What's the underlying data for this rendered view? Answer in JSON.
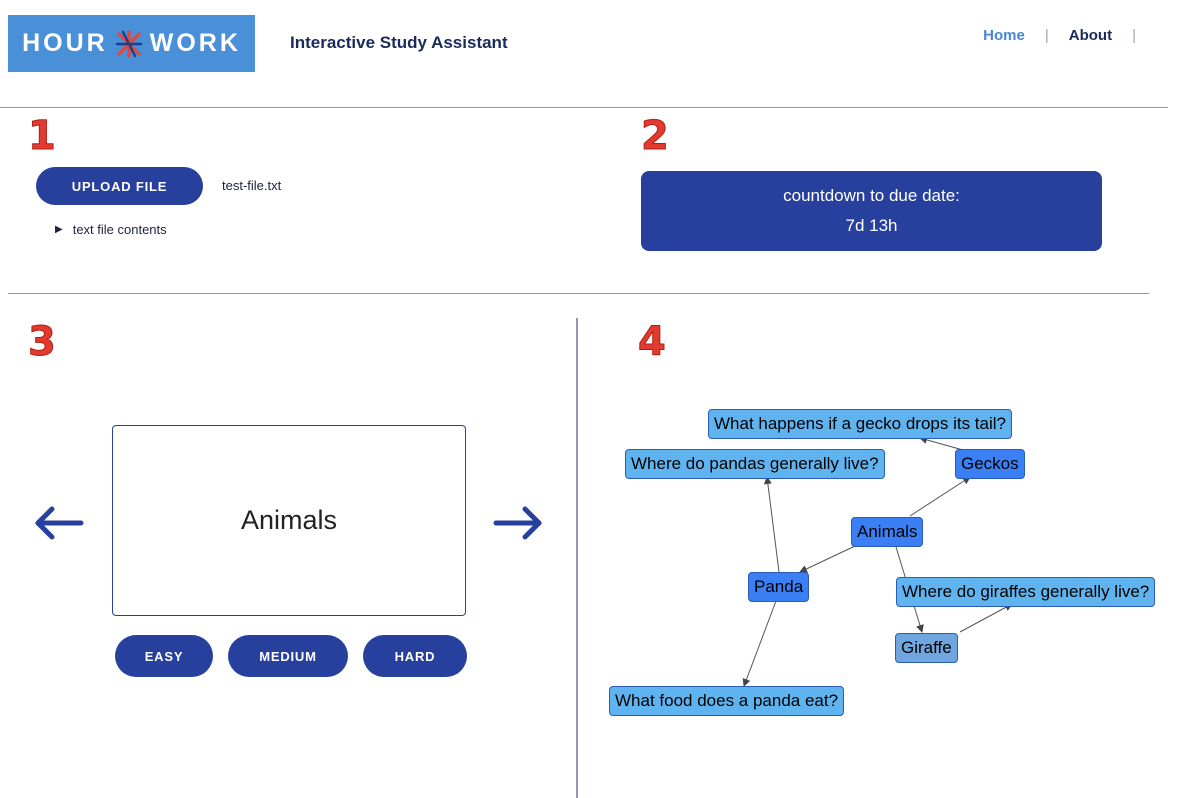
{
  "header": {
    "logo_left": "HOUR",
    "logo_right": "WORK",
    "app_title": "Interactive Study Assistant",
    "nav": [
      {
        "label": "Home",
        "active": true
      },
      {
        "label": "About",
        "active": false
      }
    ]
  },
  "steps": [
    "1",
    "2",
    "3",
    "4"
  ],
  "upload": {
    "button_label": "UPLOAD FILE",
    "file_name": "test-file.txt",
    "details_label": "text file contents"
  },
  "countdown": {
    "label": "countdown to due date:",
    "value": "7d 13h"
  },
  "flashcard": {
    "text": "Animals",
    "difficulty_buttons": [
      "EASY",
      "MEDIUM",
      "HARD"
    ]
  },
  "graph": {
    "nodes": [
      {
        "id": "q_gecko_tail",
        "label": "What happens if a gecko drops its tail?",
        "kind": "question"
      },
      {
        "id": "q_pandas_live",
        "label": "Where do pandas generally live?",
        "kind": "question"
      },
      {
        "id": "geckos",
        "label": "Geckos",
        "kind": "topic"
      },
      {
        "id": "animals",
        "label": "Animals",
        "kind": "topic"
      },
      {
        "id": "panda",
        "label": "Panda",
        "kind": "topic"
      },
      {
        "id": "q_giraffes_live",
        "label": "Where do giraffes generally live?",
        "kind": "question"
      },
      {
        "id": "giraffe",
        "label": "Giraffe",
        "kind": "topic"
      },
      {
        "id": "q_panda_food",
        "label": "What food does a panda eat?",
        "kind": "question"
      }
    ],
    "edges": [
      {
        "from": "animals",
        "to": "geckos"
      },
      {
        "from": "animals",
        "to": "panda"
      },
      {
        "from": "animals",
        "to": "giraffe"
      },
      {
        "from": "geckos",
        "to": "q_gecko_tail"
      },
      {
        "from": "panda",
        "to": "q_pandas_live"
      },
      {
        "from": "panda",
        "to": "q_panda_food"
      },
      {
        "from": "giraffe",
        "to": "q_giraffes_live"
      }
    ]
  },
  "colors": {
    "primary": "#27409e",
    "logo_bg": "#4a90d9",
    "step_number": "#e23a2f",
    "question_node": "#5fb4f0",
    "topic_node": "#3b7ff5"
  }
}
